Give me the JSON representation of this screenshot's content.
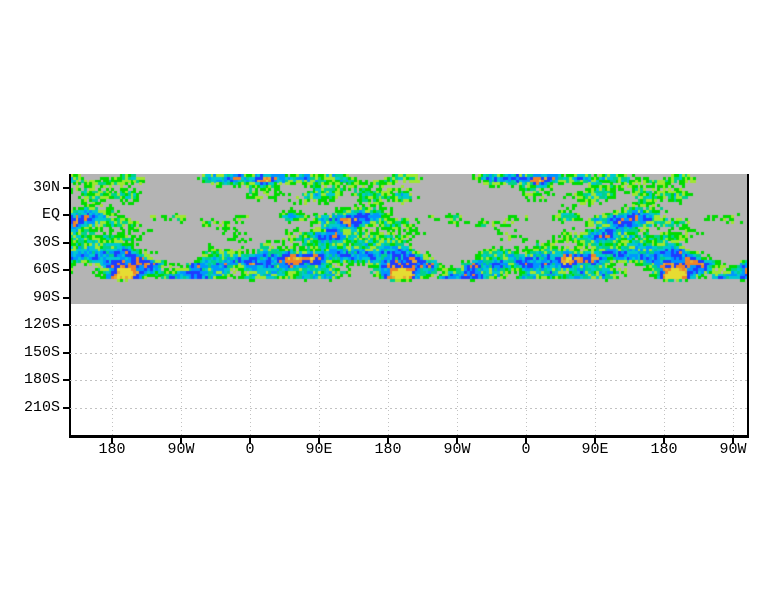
{
  "page": {
    "background_color": "#ffffff",
    "title": ""
  },
  "chart_data": {
    "type": "heatmap",
    "title": "",
    "xlabel": "",
    "ylabel": "",
    "x_axis": {
      "tick_labels": [
        "180",
        "90W",
        "0",
        "90E",
        "180",
        "90W",
        "0",
        "90E",
        "180",
        "90W"
      ],
      "note": "longitude axis wraps around the globe roughly two and a half times; labels every 90 degrees",
      "grid": "dotted vertical gridlines below the shaded band only"
    },
    "y_axis": {
      "tick_labels": [
        "30N",
        "EQ",
        "30S",
        "60S",
        "90S",
        "120S",
        "150S",
        "180S",
        "210S"
      ],
      "note": "latitude labels every 30 degrees, extending past the pole to 210S; area south of the gray band is blank white",
      "grid": "dotted horizontal gridlines at 120S, 150S, 180S, 210S"
    },
    "field": {
      "missing_color": "#b4b4b4",
      "palette_low_to_high": [
        "#00dc00",
        "#a0e632",
        "#00d28c",
        "#00c8d2",
        "#0096ff",
        "#1e3cff",
        "#f08228",
        "#e6aa32",
        "#e6dc32"
      ],
      "description": "speckled filled-contour field (GrADS-style rainbow shading) on a gray missing-data band spanning about 50N to 90S; colored speckles (greens, aquas, blues with orange/yellow cores) form filament bands near 30N, the equator and 30S-60S, fading out by about 65S; plain gray from there to 90S",
      "periodicity": "the speckle pattern repeats with each 360-degree longitude cycle (about every 276 px)"
    },
    "frame": {
      "color": "#000000",
      "sides": "left, right and thick bottom axis drawn; no top frame line above the shaded band"
    },
    "legend": "none"
  }
}
